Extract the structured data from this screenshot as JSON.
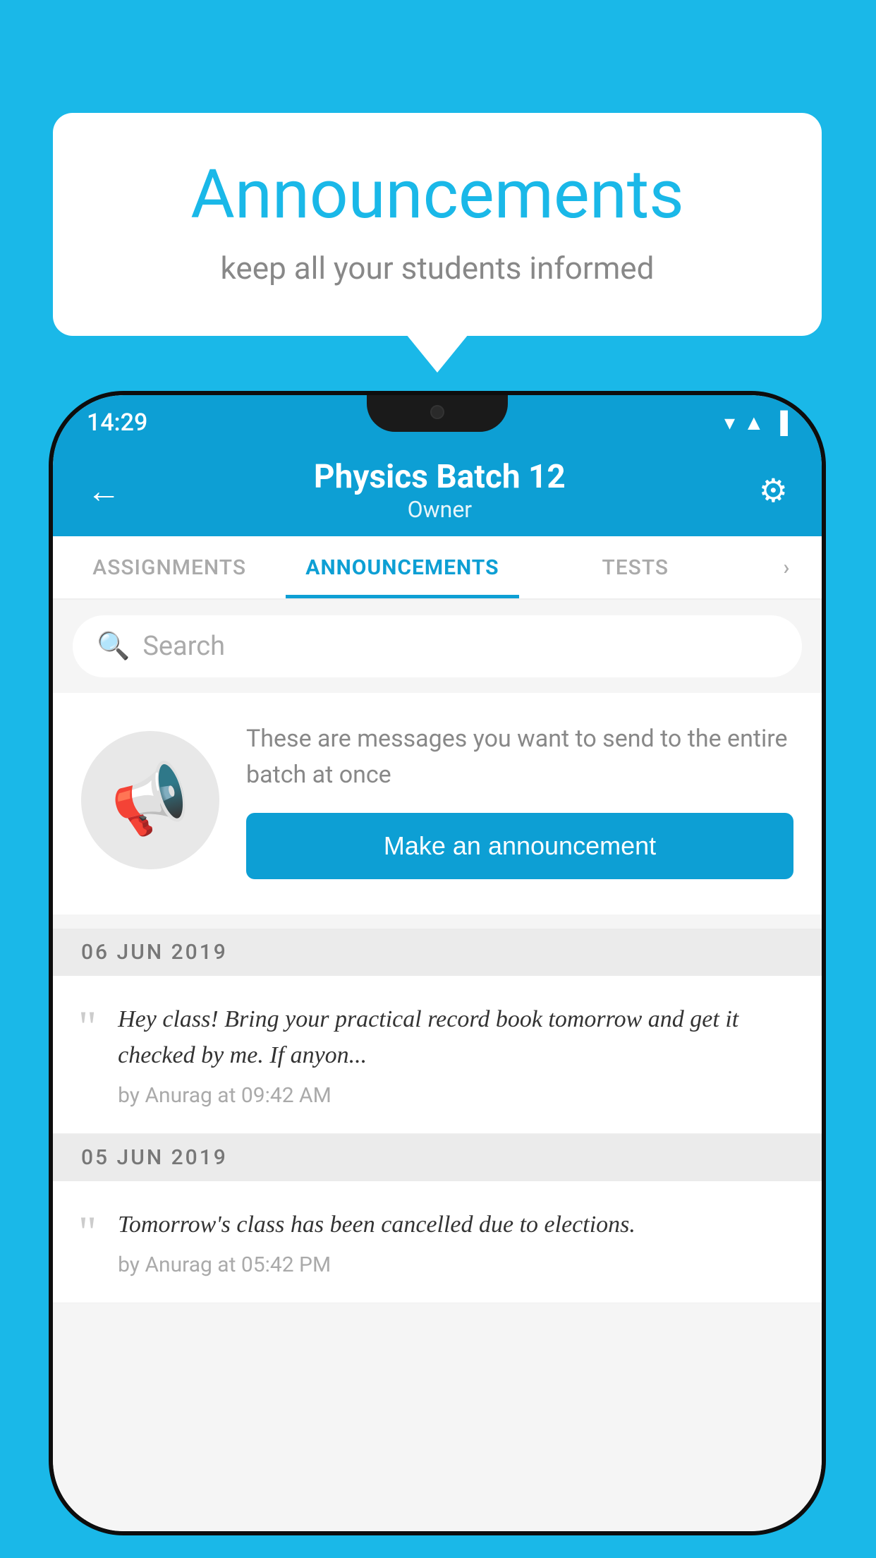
{
  "background_color": "#1ab8e8",
  "speech_bubble": {
    "title": "Announcements",
    "subtitle": "keep all your students informed"
  },
  "phone": {
    "status_bar": {
      "time": "14:29"
    },
    "header": {
      "title": "Physics Batch 12",
      "subtitle": "Owner",
      "back_label": "←",
      "settings_label": "⚙"
    },
    "tabs": [
      {
        "label": "ASSIGNMENTS",
        "active": false
      },
      {
        "label": "ANNOUNCEMENTS",
        "active": true
      },
      {
        "label": "TESTS",
        "active": false
      }
    ],
    "search": {
      "placeholder": "Search"
    },
    "empty_state": {
      "description": "These are messages you want to send to the entire batch at once",
      "button_label": "Make an announcement"
    },
    "date_groups": [
      {
        "date": "06  JUN  2019",
        "items": [
          {
            "message": "Hey class! Bring your practical record book tomorrow and get it checked by me. If anyon...",
            "meta": "by Anurag at 09:42 AM"
          }
        ]
      },
      {
        "date": "05  JUN  2019",
        "items": [
          {
            "message": "Tomorrow's class has been cancelled due to elections.",
            "meta": "by Anurag at 05:42 PM"
          }
        ]
      }
    ]
  }
}
